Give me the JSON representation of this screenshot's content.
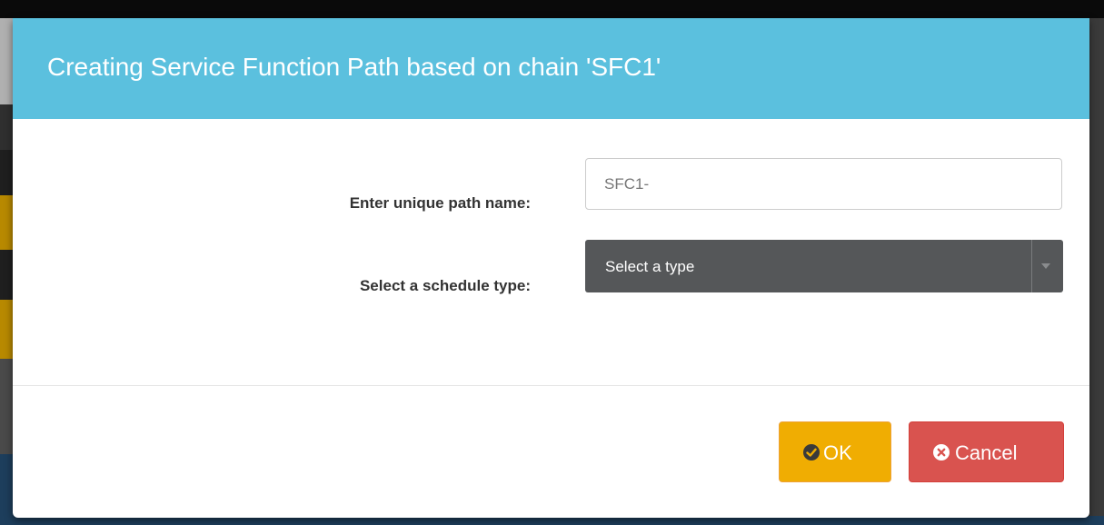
{
  "modal": {
    "title": "Creating Service Function Path based on chain 'SFC1'"
  },
  "form": {
    "path_name_label": "Enter unique path name:",
    "path_name_value": "SFC1-",
    "schedule_type_label": "Select a schedule type:",
    "schedule_type_selected": "Select a type"
  },
  "footer": {
    "ok_label": "OK",
    "ok_icon": "check-circle-icon",
    "cancel_label": "Cancel",
    "cancel_icon": "times-circle-icon"
  },
  "colors": {
    "header": "#5bc0de",
    "ok_button": "#f0ad02",
    "cancel_button": "#d9534f",
    "select_background": "#555759"
  }
}
